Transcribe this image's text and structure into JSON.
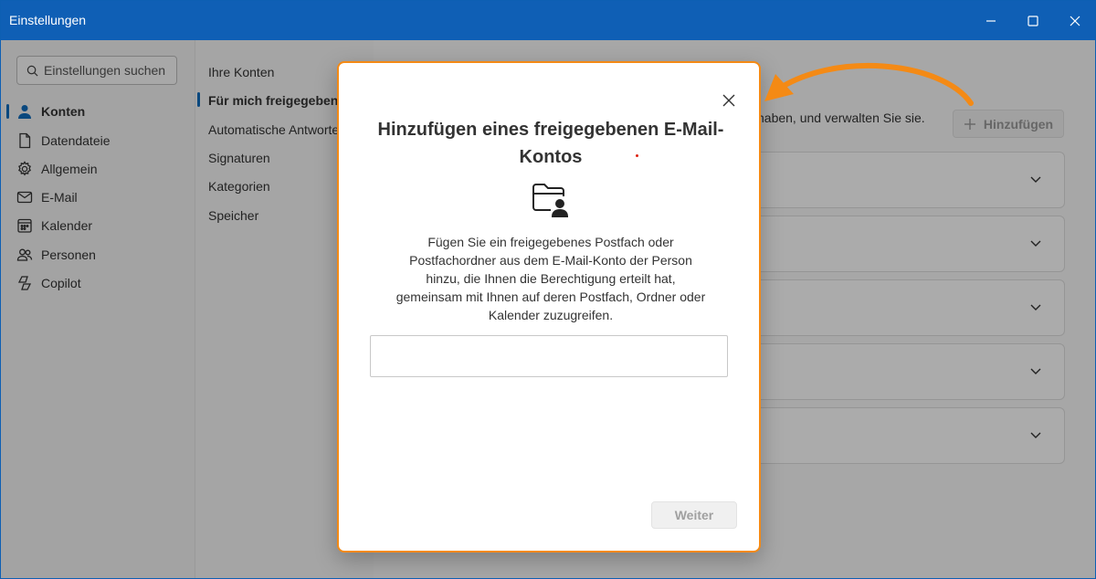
{
  "window": {
    "title": "Einstellungen"
  },
  "search": {
    "placeholder": "Einstellungen suchen"
  },
  "leftnav": {
    "items": [
      {
        "label": "Konten",
        "icon": "person-icon"
      },
      {
        "label": "Datendateie",
        "icon": "document-icon"
      },
      {
        "label": "Allgemein",
        "icon": "gear-icon"
      },
      {
        "label": "E-Mail",
        "icon": "mail-icon"
      },
      {
        "label": "Kalender",
        "icon": "calendar-icon"
      },
      {
        "label": "Personen",
        "icon": "people-icon"
      },
      {
        "label": "Copilot",
        "icon": "copilot-icon"
      }
    ]
  },
  "subnav": {
    "items": [
      {
        "label": "Ihre Konten"
      },
      {
        "label": "Für mich freigegeben"
      },
      {
        "label": "Automatische Antworte"
      },
      {
        "label": "Signaturen"
      },
      {
        "label": "Kategorien"
      },
      {
        "label": "Speicher"
      }
    ]
  },
  "content": {
    "description": "haben, und verwalten Sie sie.",
    "add_label": "Hinzufügen"
  },
  "dialog": {
    "title": "Hinzufügen eines freigegebenen E-Mail-Kontos",
    "body": "Fügen Sie ein freigegebenes Postfach oder Postfachordner aus dem E-Mail-Konto der Person hinzu, die Ihnen die Berechtigung erteilt hat, gemeinsam mit Ihnen auf deren Postfach, Ordner oder Kalender zuzugreifen.",
    "input_value": "",
    "next_label": "Weiter"
  },
  "colors": {
    "titlebar": "#0f5fb5",
    "accent": "#0f6cbd",
    "highlight": "#f48a15"
  }
}
